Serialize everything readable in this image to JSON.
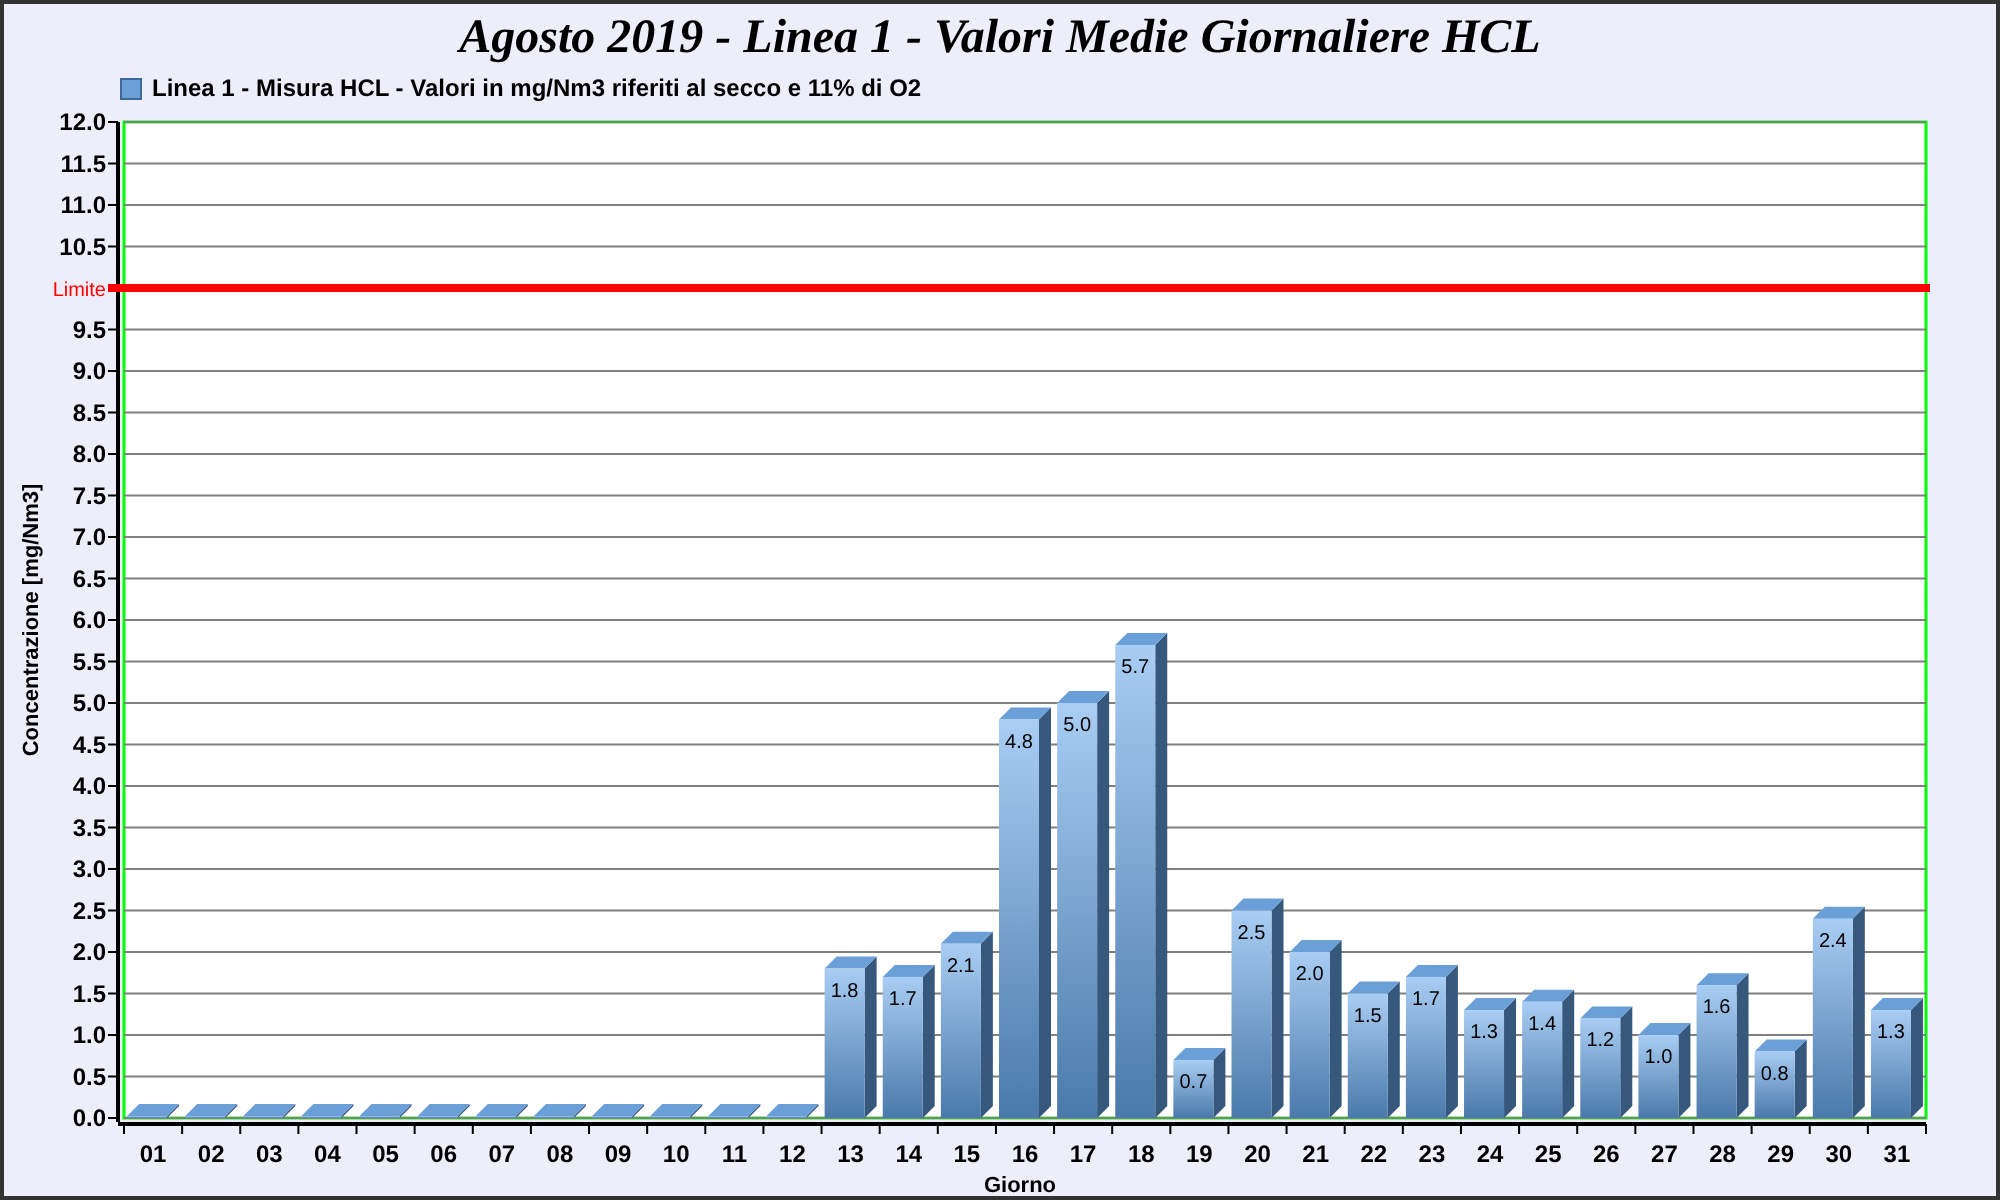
{
  "chart": {
    "chart_data": {
      "type": "bar",
      "title": "Agosto 2019 - Linea 1 - Valori Medie Giornaliere HCL",
      "xlabel": "Giorno",
      "ylabel": "Concentrazione [mg/Nm3]",
      "categories": [
        "01",
        "02",
        "03",
        "04",
        "05",
        "06",
        "07",
        "08",
        "09",
        "10",
        "11",
        "12",
        "13",
        "14",
        "15",
        "16",
        "17",
        "18",
        "19",
        "20",
        "21",
        "22",
        "23",
        "24",
        "25",
        "26",
        "27",
        "28",
        "29",
        "30",
        "31"
      ],
      "series": [
        {
          "name": "Linea 1 - Misura HCL - Valori in mg/Nm3 riferiti al secco e 11% di O2",
          "color": "#6a9fd8",
          "values": [
            0,
            0,
            0,
            0,
            0,
            0,
            0,
            0,
            0,
            0,
            0,
            0,
            1.8,
            1.7,
            2.1,
            4.8,
            5.0,
            5.7,
            0.7,
            2.5,
            2.0,
            1.5,
            1.7,
            1.3,
            1.4,
            1.2,
            1.0,
            1.6,
            0.8,
            2.4,
            1.3
          ]
        }
      ],
      "value_labels": [
        null,
        null,
        null,
        null,
        null,
        null,
        null,
        null,
        null,
        null,
        null,
        null,
        "1.8",
        "1.7",
        "2.1",
        "4.8",
        "5.0",
        "5.7",
        "0.7",
        "2.5",
        "2.0",
        "1.5",
        "1.7",
        "1.3",
        "1.4",
        "1.2",
        "1.0",
        "1.6",
        "0.8",
        "2.4",
        "1.3"
      ],
      "grid": true,
      "ylim": [
        0,
        12
      ],
      "yticks": [
        {
          "value": 0,
          "label": "0.0"
        },
        {
          "value": 0.5,
          "label": "0.5"
        },
        {
          "value": 1,
          "label": "1.0"
        },
        {
          "value": 1.5,
          "label": "1.5"
        },
        {
          "value": 2,
          "label": "2.0"
        },
        {
          "value": 2.5,
          "label": "2.5"
        },
        {
          "value": 3,
          "label": "3.0"
        },
        {
          "value": 3.5,
          "label": "3.5"
        },
        {
          "value": 4,
          "label": "4.0"
        },
        {
          "value": 4.5,
          "label": "4.5"
        },
        {
          "value": 5,
          "label": "5.0"
        },
        {
          "value": 5.5,
          "label": "5.5"
        },
        {
          "value": 6,
          "label": "6.0"
        },
        {
          "value": 6.5,
          "label": "6.5"
        },
        {
          "value": 7,
          "label": "7.0"
        },
        {
          "value": 7.5,
          "label": "7.5"
        },
        {
          "value": 8,
          "label": "8.0"
        },
        {
          "value": 8.5,
          "label": "8.5"
        },
        {
          "value": 9,
          "label": "9.0"
        },
        {
          "value": 9.5,
          "label": "9.5"
        },
        {
          "value": 10.5,
          "label": "10.5"
        },
        {
          "value": 11,
          "label": "11.0"
        },
        {
          "value": 11.5,
          "label": "11.5"
        },
        {
          "value": 12,
          "label": "12.0"
        }
      ],
      "ref_lines": [
        {
          "axis": "y",
          "value": 10,
          "label": "Limite",
          "color": "#ff0000"
        }
      ]
    }
  }
}
